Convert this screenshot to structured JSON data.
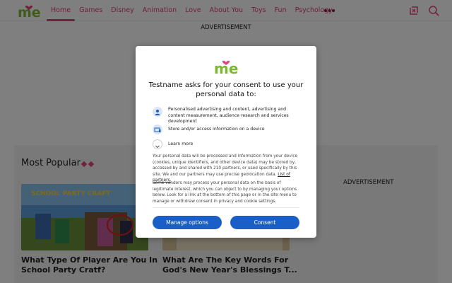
{
  "header": {
    "logo_text": "me",
    "nav": [
      "Home",
      "Games",
      "Disney",
      "Animation",
      "Love",
      "About You",
      "Toys",
      "Fun",
      "Psychology"
    ]
  },
  "page": {
    "ad_label_top": "ADVERTISEMENT",
    "most_popular": "Most Popular",
    "ad_label_side": "ADVERTISEMENT",
    "cards": [
      {
        "title": "What Type Of Player Are You In School Party Cratf?",
        "image_caption": "SCHOOL PARTY CRAFT"
      },
      {
        "title": "What Are The Key Words For God's New Year's Blessings T..."
      }
    ]
  },
  "consent": {
    "logo_text": "me",
    "heading": "Testname asks for your consent to use your personal data to:",
    "purposes": [
      {
        "icon": "person-icon",
        "text": "Personalised advertising and content, advertising and content measurement, audience research and services development"
      },
      {
        "icon": "device-icon",
        "text": "Store and/or access information on a device"
      }
    ],
    "learn_more": "Learn more",
    "para1": "Your personal data will be processed and information from your device (cookies, unique identifiers, and other device data) may be stored by, accessed by and shared with 210 partners, or used specifically by this site. We and our partners may use precise geolocation data.",
    "partners_link": "List of partners.",
    "para2": "Some vendors may process your personal data on the basis of legitimate interest, which you can object to by managing your options below. Look for a link at the bottom of this page or in the site menu to manage or withdraw consent in privacy and cookie settings.",
    "manage_label": "Manage options",
    "consent_label": "Consent"
  },
  "colors": {
    "brand_pink": "#e2407b",
    "button_blue": "#1a5fc8",
    "overlay": "rgba(0,0,0,0.5)"
  }
}
